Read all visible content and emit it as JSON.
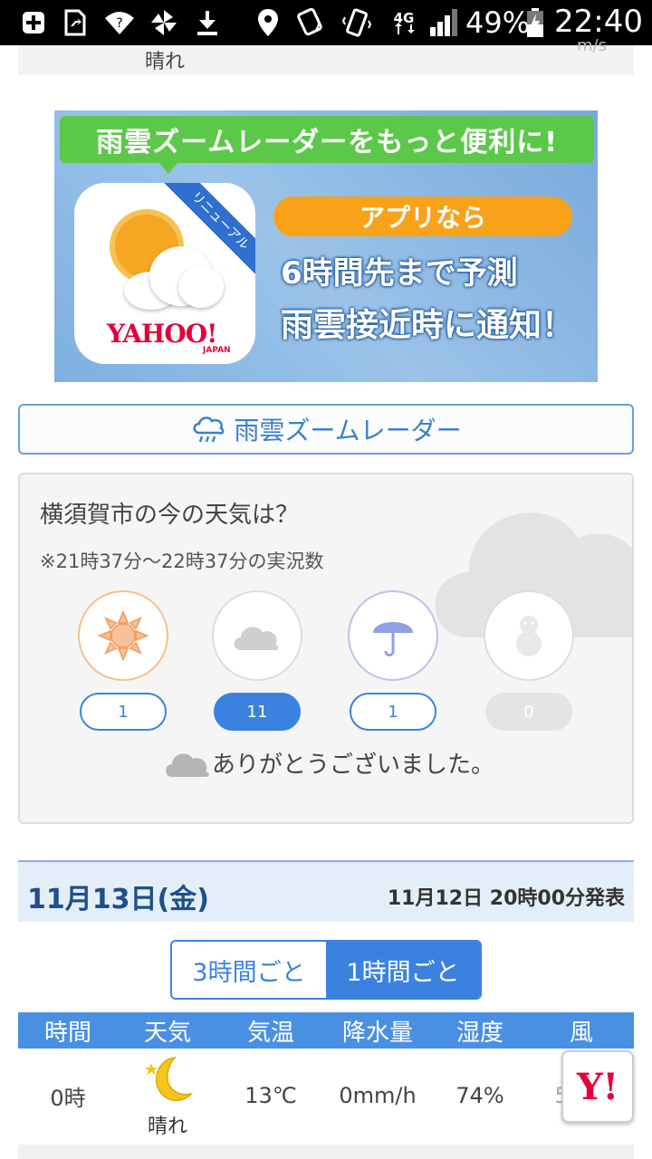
{
  "status_bar": {
    "battery_percent": "49%",
    "network": "4G",
    "time": "22:40"
  },
  "prev_row": {
    "weather": "晴れ",
    "wind_unit": "m/s"
  },
  "banner": {
    "headline": "雨雲ズームレーダーをもっと便利に!",
    "badge": "リニューアル",
    "brand": "YAHOO!",
    "brand_sub": "JAPAN",
    "pill": "アプリなら",
    "line1": "6時間先まで予測",
    "line2": "雨雲接近時に通知！"
  },
  "radar_button": {
    "label": "雨雲ズームレーダー",
    "icon": "rain-cloud-icon"
  },
  "current_weather": {
    "title": "横須賀市の今の天気は？",
    "note": "※21時37分〜22時37分の実況数",
    "options": [
      {
        "icon": "sun-icon",
        "count": "1"
      },
      {
        "icon": "cloud-icon",
        "count": "11"
      },
      {
        "icon": "umbrella-icon",
        "count": "1"
      },
      {
        "icon": "snowman-icon",
        "count": "0"
      }
    ],
    "thanks": "ありがとうございました。"
  },
  "forecast": {
    "date": "11月13日(金)",
    "issued": "11月12日 20時00分発表",
    "toggle": {
      "opt1": "3時間ごと",
      "opt2": "1時間ごと",
      "selected": "1時間ごと"
    },
    "headers": {
      "time": "時間",
      "weather": "天気",
      "temp": "気温",
      "rain": "降水量",
      "humidity": "湿度",
      "wind": "風"
    },
    "rows": [
      {
        "time": "0時",
        "weather": "晴れ",
        "weather_icon": "moon-icon",
        "temp": "13℃",
        "rain": "0mm/h",
        "humidity": "74%",
        "wind": "5m/s"
      }
    ]
  },
  "fab": {
    "label": "Y!"
  },
  "colors": {
    "accent": "#3b82e0",
    "header_blue": "#4a90e2",
    "banner_green": "#5cc84a",
    "banner_orange": "#f8a21a",
    "yahoo_red": "#e4003a"
  }
}
